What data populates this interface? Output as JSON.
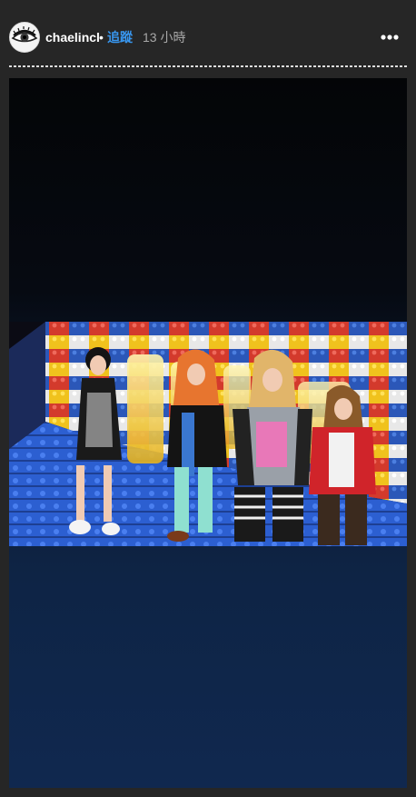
{
  "header": {
    "username": "chaelincl",
    "separator": "•",
    "follow_label": "追蹤",
    "timestamp": "13 小時"
  },
  "icons": {
    "avatar": "profile-avatar-eye",
    "more": "more-horizontal-icon"
  },
  "story": {
    "progress_segments": 1,
    "photo_label": "",
    "background_top": "#040507",
    "background_bottom": "#10284f"
  },
  "colors": {
    "page_background": "#262626",
    "follow_link": "#3897f0",
    "username": "#ffffff",
    "timestamp": "#a8a8a8"
  }
}
